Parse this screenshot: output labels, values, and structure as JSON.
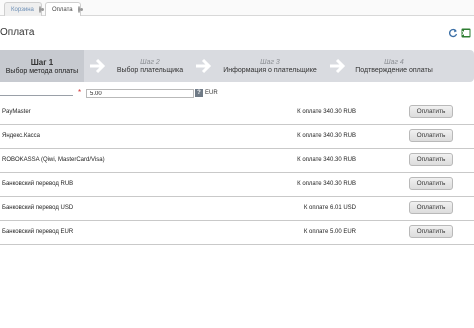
{
  "tabs": [
    {
      "label": "Корзина",
      "active": false
    },
    {
      "label": "Оплата",
      "active": true
    }
  ],
  "page": {
    "title": "Оплата"
  },
  "toolbar": {
    "icons": [
      "refresh-icon",
      "excel-export-icon"
    ]
  },
  "steps": [
    {
      "number": "Шаг 1",
      "label": "Выбор метода оплаты",
      "active": true
    },
    {
      "number": "Шаг 2",
      "label": "Выбор плательщика",
      "active": false
    },
    {
      "number": "Шаг 3",
      "label": "Информация о плательщике",
      "active": false
    },
    {
      "number": "Шаг 4",
      "label": "Подтверждение оплаты",
      "active": false
    }
  ],
  "amount": {
    "required_mark": "*",
    "value": "5.00",
    "help_label": "?",
    "currency": "EUR"
  },
  "methods": [
    {
      "name": "PayMaster",
      "amount_text": "К оплате 340.30 RUB",
      "button_label": "Оплатить"
    },
    {
      "name": "Яндекс.Касса",
      "amount_text": "К оплате 340.30 RUB",
      "button_label": "Оплатить"
    },
    {
      "name": "ROBOKASSA (Qiwi, MasterCard/Visa)",
      "amount_text": "К оплате 340.30 RUB",
      "button_label": "Оплатить"
    },
    {
      "name": "Банковский перевод RUB",
      "amount_text": "К оплате 340.30 RUB",
      "button_label": "Оплатить"
    },
    {
      "name": "Банковский перевод USD",
      "amount_text": "К оплате 6.01 USD",
      "button_label": "Оплатить"
    },
    {
      "name": "Банковский перевод EUR",
      "amount_text": "К оплате 5.00 EUR",
      "button_label": "Оплатить"
    }
  ],
  "colors": {
    "step_bar": "#d9dbe0",
    "step_active": "#c7cad0",
    "required": "#d43030",
    "excel_green": "#2e7d32"
  }
}
